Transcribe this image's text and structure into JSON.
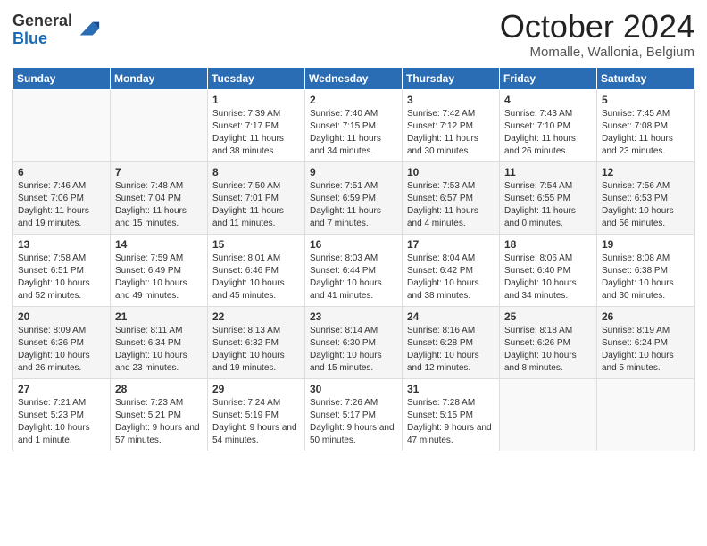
{
  "logo": {
    "general": "General",
    "blue": "Blue"
  },
  "header": {
    "month": "October 2024",
    "location": "Momalle, Wallonia, Belgium"
  },
  "weekdays": [
    "Sunday",
    "Monday",
    "Tuesday",
    "Wednesday",
    "Thursday",
    "Friday",
    "Saturday"
  ],
  "weeks": [
    [
      {
        "day": "",
        "sunrise": "",
        "sunset": "",
        "daylight": ""
      },
      {
        "day": "",
        "sunrise": "",
        "sunset": "",
        "daylight": ""
      },
      {
        "day": "1",
        "sunrise": "Sunrise: 7:39 AM",
        "sunset": "Sunset: 7:17 PM",
        "daylight": "Daylight: 11 hours and 38 minutes."
      },
      {
        "day": "2",
        "sunrise": "Sunrise: 7:40 AM",
        "sunset": "Sunset: 7:15 PM",
        "daylight": "Daylight: 11 hours and 34 minutes."
      },
      {
        "day": "3",
        "sunrise": "Sunrise: 7:42 AM",
        "sunset": "Sunset: 7:12 PM",
        "daylight": "Daylight: 11 hours and 30 minutes."
      },
      {
        "day": "4",
        "sunrise": "Sunrise: 7:43 AM",
        "sunset": "Sunset: 7:10 PM",
        "daylight": "Daylight: 11 hours and 26 minutes."
      },
      {
        "day": "5",
        "sunrise": "Sunrise: 7:45 AM",
        "sunset": "Sunset: 7:08 PM",
        "daylight": "Daylight: 11 hours and 23 minutes."
      }
    ],
    [
      {
        "day": "6",
        "sunrise": "Sunrise: 7:46 AM",
        "sunset": "Sunset: 7:06 PM",
        "daylight": "Daylight: 11 hours and 19 minutes."
      },
      {
        "day": "7",
        "sunrise": "Sunrise: 7:48 AM",
        "sunset": "Sunset: 7:04 PM",
        "daylight": "Daylight: 11 hours and 15 minutes."
      },
      {
        "day": "8",
        "sunrise": "Sunrise: 7:50 AM",
        "sunset": "Sunset: 7:01 PM",
        "daylight": "Daylight: 11 hours and 11 minutes."
      },
      {
        "day": "9",
        "sunrise": "Sunrise: 7:51 AM",
        "sunset": "Sunset: 6:59 PM",
        "daylight": "Daylight: 11 hours and 7 minutes."
      },
      {
        "day": "10",
        "sunrise": "Sunrise: 7:53 AM",
        "sunset": "Sunset: 6:57 PM",
        "daylight": "Daylight: 11 hours and 4 minutes."
      },
      {
        "day": "11",
        "sunrise": "Sunrise: 7:54 AM",
        "sunset": "Sunset: 6:55 PM",
        "daylight": "Daylight: 11 hours and 0 minutes."
      },
      {
        "day": "12",
        "sunrise": "Sunrise: 7:56 AM",
        "sunset": "Sunset: 6:53 PM",
        "daylight": "Daylight: 10 hours and 56 minutes."
      }
    ],
    [
      {
        "day": "13",
        "sunrise": "Sunrise: 7:58 AM",
        "sunset": "Sunset: 6:51 PM",
        "daylight": "Daylight: 10 hours and 52 minutes."
      },
      {
        "day": "14",
        "sunrise": "Sunrise: 7:59 AM",
        "sunset": "Sunset: 6:49 PM",
        "daylight": "Daylight: 10 hours and 49 minutes."
      },
      {
        "day": "15",
        "sunrise": "Sunrise: 8:01 AM",
        "sunset": "Sunset: 6:46 PM",
        "daylight": "Daylight: 10 hours and 45 minutes."
      },
      {
        "day": "16",
        "sunrise": "Sunrise: 8:03 AM",
        "sunset": "Sunset: 6:44 PM",
        "daylight": "Daylight: 10 hours and 41 minutes."
      },
      {
        "day": "17",
        "sunrise": "Sunrise: 8:04 AM",
        "sunset": "Sunset: 6:42 PM",
        "daylight": "Daylight: 10 hours and 38 minutes."
      },
      {
        "day": "18",
        "sunrise": "Sunrise: 8:06 AM",
        "sunset": "Sunset: 6:40 PM",
        "daylight": "Daylight: 10 hours and 34 minutes."
      },
      {
        "day": "19",
        "sunrise": "Sunrise: 8:08 AM",
        "sunset": "Sunset: 6:38 PM",
        "daylight": "Daylight: 10 hours and 30 minutes."
      }
    ],
    [
      {
        "day": "20",
        "sunrise": "Sunrise: 8:09 AM",
        "sunset": "Sunset: 6:36 PM",
        "daylight": "Daylight: 10 hours and 26 minutes."
      },
      {
        "day": "21",
        "sunrise": "Sunrise: 8:11 AM",
        "sunset": "Sunset: 6:34 PM",
        "daylight": "Daylight: 10 hours and 23 minutes."
      },
      {
        "day": "22",
        "sunrise": "Sunrise: 8:13 AM",
        "sunset": "Sunset: 6:32 PM",
        "daylight": "Daylight: 10 hours and 19 minutes."
      },
      {
        "day": "23",
        "sunrise": "Sunrise: 8:14 AM",
        "sunset": "Sunset: 6:30 PM",
        "daylight": "Daylight: 10 hours and 15 minutes."
      },
      {
        "day": "24",
        "sunrise": "Sunrise: 8:16 AM",
        "sunset": "Sunset: 6:28 PM",
        "daylight": "Daylight: 10 hours and 12 minutes."
      },
      {
        "day": "25",
        "sunrise": "Sunrise: 8:18 AM",
        "sunset": "Sunset: 6:26 PM",
        "daylight": "Daylight: 10 hours and 8 minutes."
      },
      {
        "day": "26",
        "sunrise": "Sunrise: 8:19 AM",
        "sunset": "Sunset: 6:24 PM",
        "daylight": "Daylight: 10 hours and 5 minutes."
      }
    ],
    [
      {
        "day": "27",
        "sunrise": "Sunrise: 7:21 AM",
        "sunset": "Sunset: 5:23 PM",
        "daylight": "Daylight: 10 hours and 1 minute."
      },
      {
        "day": "28",
        "sunrise": "Sunrise: 7:23 AM",
        "sunset": "Sunset: 5:21 PM",
        "daylight": "Daylight: 9 hours and 57 minutes."
      },
      {
        "day": "29",
        "sunrise": "Sunrise: 7:24 AM",
        "sunset": "Sunset: 5:19 PM",
        "daylight": "Daylight: 9 hours and 54 minutes."
      },
      {
        "day": "30",
        "sunrise": "Sunrise: 7:26 AM",
        "sunset": "Sunset: 5:17 PM",
        "daylight": "Daylight: 9 hours and 50 minutes."
      },
      {
        "day": "31",
        "sunrise": "Sunrise: 7:28 AM",
        "sunset": "Sunset: 5:15 PM",
        "daylight": "Daylight: 9 hours and 47 minutes."
      },
      {
        "day": "",
        "sunrise": "",
        "sunset": "",
        "daylight": ""
      },
      {
        "day": "",
        "sunrise": "",
        "sunset": "",
        "daylight": ""
      }
    ]
  ]
}
